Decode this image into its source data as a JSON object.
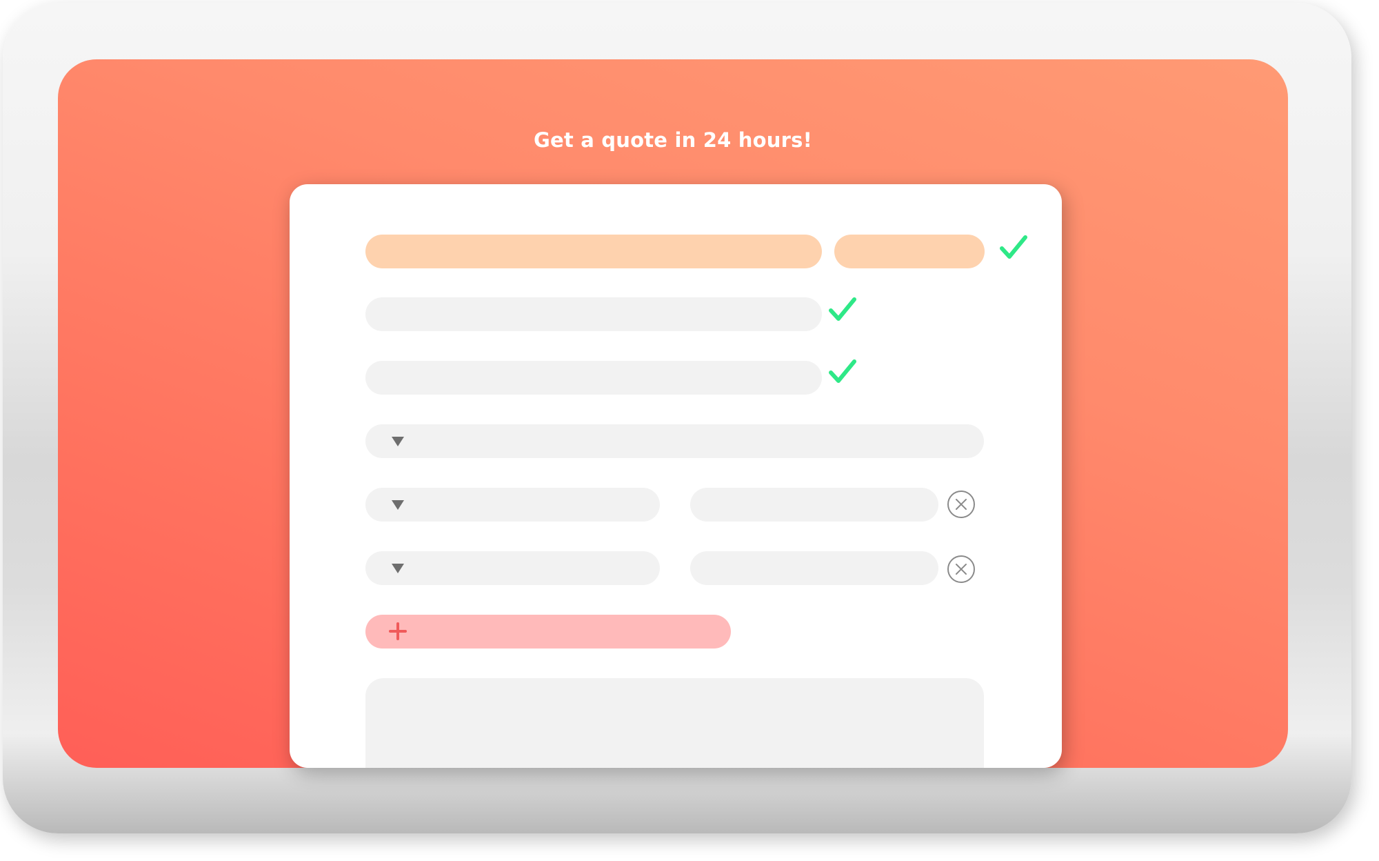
{
  "page": {
    "headline": "Get a quote in 24 hours!"
  },
  "form": {
    "name_first_value": "",
    "name_last_value": "",
    "email_value": "",
    "phone_value": "",
    "service_select_value": "",
    "item_rows": [
      {
        "select_value": "",
        "quantity_value": ""
      },
      {
        "select_value": "",
        "quantity_value": ""
      }
    ],
    "add_row_label": "",
    "message_value": ""
  },
  "icons": {
    "valid": "check-icon",
    "remove": "close-circle-icon",
    "dropdown": "caret-down-icon",
    "add": "plus-icon"
  },
  "colors": {
    "screen_gradient_start": "#ff9a74",
    "screen_gradient_end": "#ff5f57",
    "highlight_field": "#fed2ae",
    "add_button": "#ffbaba",
    "add_icon": "#f05a5a",
    "field": "#f2f2f2",
    "check": "#2ee887",
    "remove_icon": "#8a8a8a"
  }
}
